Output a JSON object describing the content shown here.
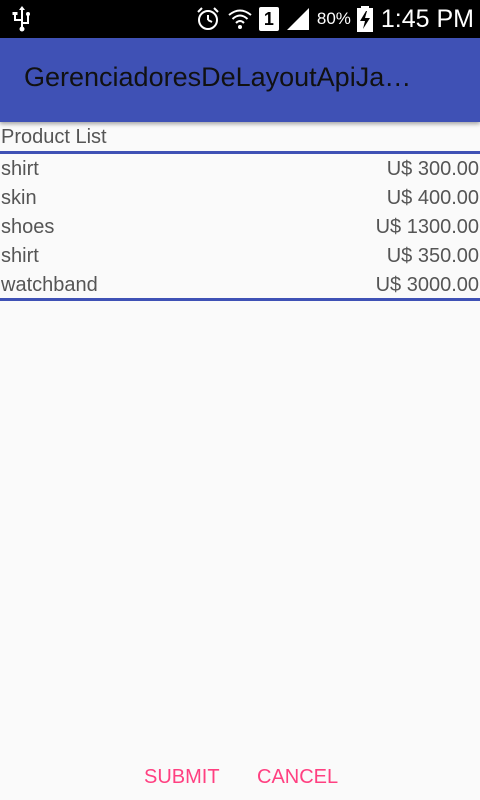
{
  "status_bar": {
    "battery_percent": "80%",
    "sim_slot": "1",
    "time": "1:45 PM",
    "icons": [
      "usb-icon",
      "alarm-icon",
      "wifi-icon",
      "sim-icon",
      "signal-icon",
      "battery-charging-icon"
    ]
  },
  "app_bar": {
    "title": "GerenciadoresDeLayoutApiJa…",
    "color": "#3f51b5"
  },
  "product_list": {
    "header": "Product List",
    "items": [
      {
        "name": "shirt",
        "price": "U$ 300.00"
      },
      {
        "name": "skin",
        "price": "U$ 400.00"
      },
      {
        "name": "shoes",
        "price": "U$ 1300.00"
      },
      {
        "name": "shirt",
        "price": "U$ 350.00"
      },
      {
        "name": "watchband",
        "price": "U$ 3000.00"
      }
    ]
  },
  "actions": {
    "submit_label": "SUBMIT",
    "cancel_label": "CANCEL",
    "accent_color": "#ff4081"
  }
}
